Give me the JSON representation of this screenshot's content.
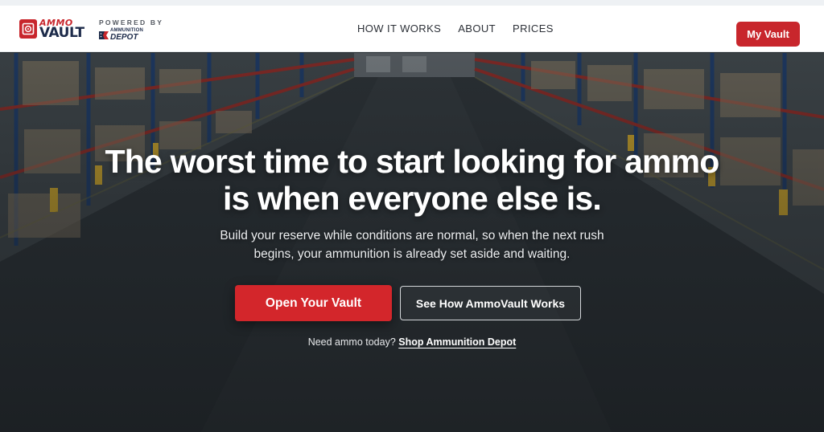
{
  "brand": {
    "logo_ammo": "AMMO",
    "logo_vault": "VAULT",
    "powered_by": "POWERED BY",
    "partner_top": "AMMUNITION",
    "partner_bottom": "DEPOT",
    "accent_color": "#c8262c",
    "navy_color": "#1d2b4a"
  },
  "nav": {
    "items": [
      {
        "label": "HOW IT WORKS"
      },
      {
        "label": "ABOUT"
      },
      {
        "label": "PRICES"
      }
    ],
    "cta_label": "My Vault"
  },
  "hero": {
    "headline_line1": "The worst time to start looking for ammo",
    "headline_line2": "is when everyone else is.",
    "subhead_line1": "Build your reserve while conditions are normal, so when the next rush",
    "subhead_line2": "begins, your ammunition is already set aside and waiting.",
    "primary_cta": "Open Your Vault",
    "secondary_cta": "See How AmmoVault Works",
    "footer_prefix": "Need ammo today?",
    "footer_link": "Shop Ammunition Depot",
    "background_icon": "warehouse-aisle-photo"
  }
}
